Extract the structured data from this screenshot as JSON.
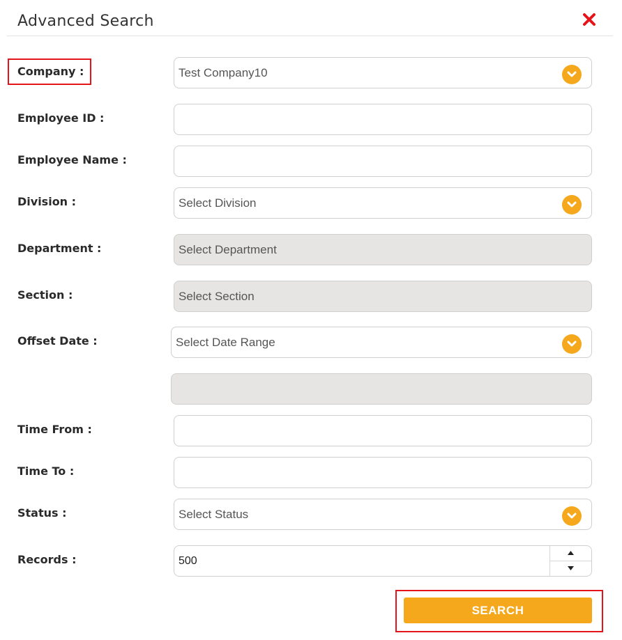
{
  "dialog": {
    "title": "Advanced Search",
    "close_icon": "close-x-icon",
    "close_color": "#e4141b"
  },
  "accent_color": "#f5a81c",
  "fields": {
    "company": {
      "label": "Company :",
      "value": "Test Company10"
    },
    "employee_id": {
      "label": "Employee ID :",
      "value": ""
    },
    "employee_name": {
      "label": "Employee Name :",
      "value": ""
    },
    "division": {
      "label": "Division :",
      "value": "Select Division"
    },
    "department": {
      "label": "Department :",
      "value": "Select Department"
    },
    "section": {
      "label": "Section :",
      "value": "Select Section"
    },
    "offset_date": {
      "label": "Offset Date :",
      "value": "Select Date Range",
      "range_value": ""
    },
    "time_from": {
      "label": "Time From :",
      "value": ""
    },
    "time_to": {
      "label": "Time To :",
      "value": ""
    },
    "status": {
      "label": "Status :",
      "value": "Select Status"
    },
    "records": {
      "label": "Records :",
      "value": "500"
    }
  },
  "search_button": {
    "label": "SEARCH"
  }
}
